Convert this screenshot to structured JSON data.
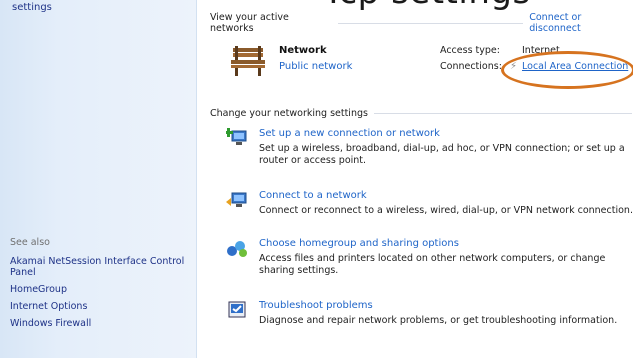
{
  "header_text": "Tcp settings",
  "sidebar": {
    "top_link": "settings",
    "see_also_label": "See also",
    "links": [
      "Akamai NetSession Interface Control Panel",
      "HomeGroup",
      "Internet Options",
      "Windows Firewall"
    ]
  },
  "active_networks": {
    "header": "View your active networks",
    "connect_disconnect": "Connect or disconnect",
    "network_name": "Network",
    "network_type": "Public network",
    "access_type_label": "Access type:",
    "access_type_value": "Internet",
    "connections_label": "Connections:",
    "connections_value": "Local Area Connection"
  },
  "change_settings": {
    "header": "Change your networking settings",
    "tasks": [
      {
        "link": "Set up a new connection or network",
        "desc": "Set up a wireless, broadband, dial-up, ad hoc, or VPN connection; or set up a router or access point.",
        "icon": "new-connection-icon"
      },
      {
        "link": "Connect to a network",
        "desc": "Connect or reconnect to a wireless, wired, dial-up, or VPN network connection.",
        "icon": "connect-network-icon"
      },
      {
        "link": "Choose homegroup and sharing options",
        "desc": "Access files and printers located on other network computers, or change sharing settings.",
        "icon": "homegroup-icon"
      },
      {
        "link": "Troubleshoot problems",
        "desc": "Diagnose and repair network problems, or get troubleshooting information.",
        "icon": "troubleshoot-icon"
      }
    ]
  },
  "colors": {
    "link": "#1e64c8",
    "sidebar_link": "#1e3287",
    "highlight_oval": "#d6731f"
  }
}
